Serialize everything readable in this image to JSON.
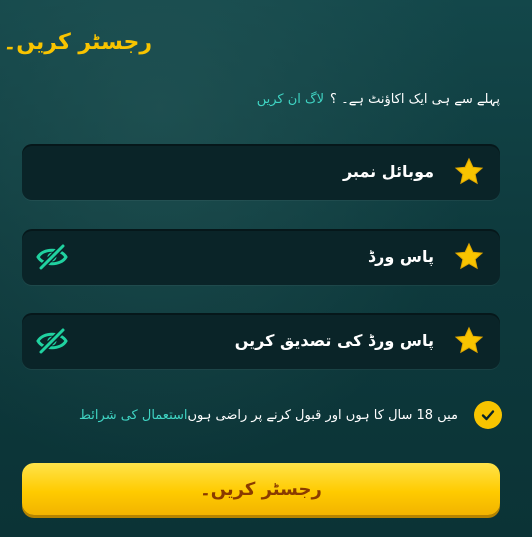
{
  "header": {
    "title": "رجسٹر کریں۔"
  },
  "login_prompt": {
    "text": "پہلے سے ہی ایک اکاؤنٹ ہے۔ ؟",
    "link": "لاگ ان کریں"
  },
  "fields": {
    "mobile": {
      "label": "موبائل نمبر",
      "icon": "star-icon"
    },
    "password": {
      "label": "پاس ورڈ",
      "icon": "star-icon",
      "toggle_icon": "eye-slash-icon"
    },
    "confirm_password": {
      "label": "پاس ورڈ کی تصدیق کریں",
      "icon": "star-icon",
      "toggle_icon": "eye-slash-icon"
    }
  },
  "terms": {
    "checked": true,
    "text": "میں 18 سال کا ہوں اور قبول کرنے پر راضی ہوں",
    "link": "استعمال کی شرائط"
  },
  "submit": {
    "label": "رجسٹر کریں۔"
  },
  "colors": {
    "accent": "#f8c400",
    "link": "#3fd3c2",
    "background": "#0f3b3e",
    "field_bg": "#0a2428",
    "button_text": "#8a3b00"
  }
}
